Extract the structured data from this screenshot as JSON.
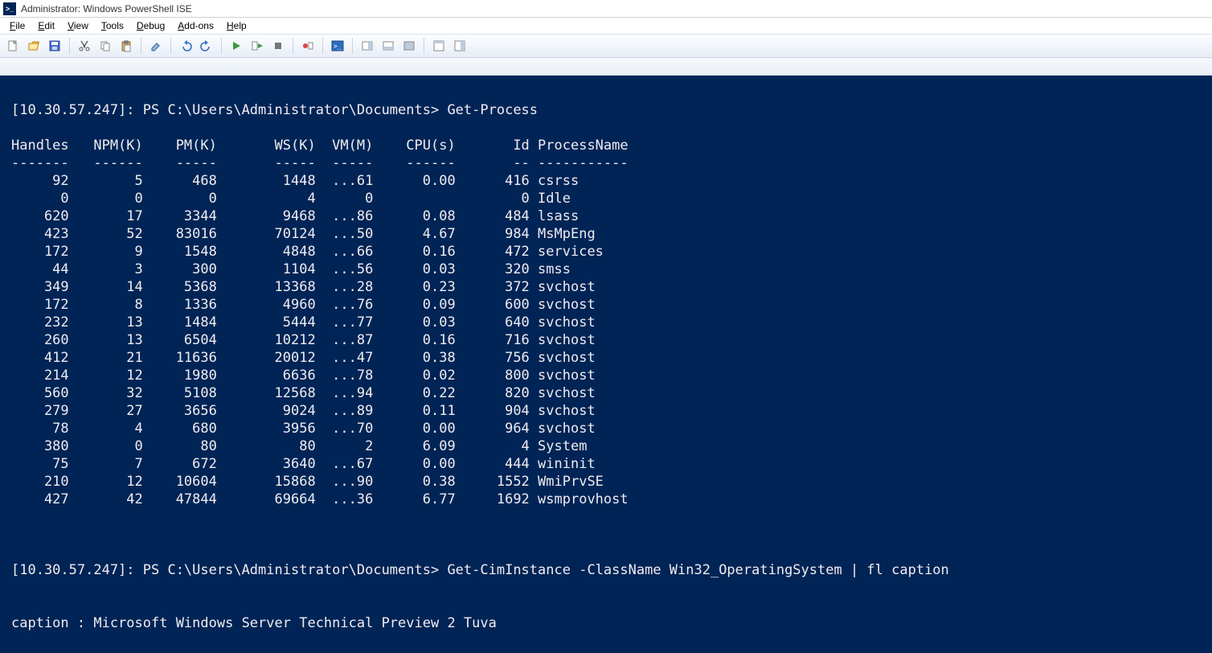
{
  "window": {
    "title": "Administrator: Windows PowerShell ISE"
  },
  "menu": {
    "file": {
      "label": "File",
      "ul": "F"
    },
    "edit": {
      "label": "Edit",
      "ul": "E"
    },
    "view": {
      "label": "View",
      "ul": "V"
    },
    "tools": {
      "label": "Tools",
      "ul": "T"
    },
    "debug": {
      "label": "Debug",
      "ul": "D"
    },
    "addons": {
      "label": "Add-ons",
      "ul": "A"
    },
    "help": {
      "label": "Help",
      "ul": "H"
    }
  },
  "toolbar_icons": [
    "new-icon",
    "open-icon",
    "save-icon",
    "sep",
    "cut-icon",
    "copy-icon",
    "paste-icon",
    "sep",
    "clear-icon",
    "sep",
    "undo-icon",
    "redo-icon",
    "sep",
    "run-icon",
    "run-selection-icon",
    "stop-icon",
    "sep",
    "breakpoint-icon",
    "sep",
    "powershell-icon",
    "sep",
    "layout-right-icon",
    "layout-bottom-icon",
    "layout-full-icon",
    "sep",
    "show-script-icon",
    "show-command-icon"
  ],
  "console": {
    "prompt1": "[10.30.57.247]: PS C:\\Users\\Administrator\\Documents> ",
    "cmd1": "Get-Process",
    "columns": [
      "Handles",
      "NPM(K)",
      "PM(K)",
      "WS(K)",
      "VM(M)",
      "CPU(s)",
      "Id",
      "ProcessName"
    ],
    "rows": [
      {
        "Handles": "92",
        "NPM": "5",
        "PM": "468",
        "WS": "1448",
        "VM": "...61",
        "CPU": "0.00",
        "Id": "416",
        "Name": "csrss"
      },
      {
        "Handles": "0",
        "NPM": "0",
        "PM": "0",
        "WS": "4",
        "VM": "0",
        "CPU": "",
        "Id": "0",
        "Name": "Idle"
      },
      {
        "Handles": "620",
        "NPM": "17",
        "PM": "3344",
        "WS": "9468",
        "VM": "...86",
        "CPU": "0.08",
        "Id": "484",
        "Name": "lsass"
      },
      {
        "Handles": "423",
        "NPM": "52",
        "PM": "83016",
        "WS": "70124",
        "VM": "...50",
        "CPU": "4.67",
        "Id": "984",
        "Name": "MsMpEng"
      },
      {
        "Handles": "172",
        "NPM": "9",
        "PM": "1548",
        "WS": "4848",
        "VM": "...66",
        "CPU": "0.16",
        "Id": "472",
        "Name": "services"
      },
      {
        "Handles": "44",
        "NPM": "3",
        "PM": "300",
        "WS": "1104",
        "VM": "...56",
        "CPU": "0.03",
        "Id": "320",
        "Name": "smss"
      },
      {
        "Handles": "349",
        "NPM": "14",
        "PM": "5368",
        "WS": "13368",
        "VM": "...28",
        "CPU": "0.23",
        "Id": "372",
        "Name": "svchost"
      },
      {
        "Handles": "172",
        "NPM": "8",
        "PM": "1336",
        "WS": "4960",
        "VM": "...76",
        "CPU": "0.09",
        "Id": "600",
        "Name": "svchost"
      },
      {
        "Handles": "232",
        "NPM": "13",
        "PM": "1484",
        "WS": "5444",
        "VM": "...77",
        "CPU": "0.03",
        "Id": "640",
        "Name": "svchost"
      },
      {
        "Handles": "260",
        "NPM": "13",
        "PM": "6504",
        "WS": "10212",
        "VM": "...87",
        "CPU": "0.16",
        "Id": "716",
        "Name": "svchost"
      },
      {
        "Handles": "412",
        "NPM": "21",
        "PM": "11636",
        "WS": "20012",
        "VM": "...47",
        "CPU": "0.38",
        "Id": "756",
        "Name": "svchost"
      },
      {
        "Handles": "214",
        "NPM": "12",
        "PM": "1980",
        "WS": "6636",
        "VM": "...78",
        "CPU": "0.02",
        "Id": "800",
        "Name": "svchost"
      },
      {
        "Handles": "560",
        "NPM": "32",
        "PM": "5108",
        "WS": "12568",
        "VM": "...94",
        "CPU": "0.22",
        "Id": "820",
        "Name": "svchost"
      },
      {
        "Handles": "279",
        "NPM": "27",
        "PM": "3656",
        "WS": "9024",
        "VM": "...89",
        "CPU": "0.11",
        "Id": "904",
        "Name": "svchost"
      },
      {
        "Handles": "78",
        "NPM": "4",
        "PM": "680",
        "WS": "3956",
        "VM": "...70",
        "CPU": "0.00",
        "Id": "964",
        "Name": "svchost"
      },
      {
        "Handles": "380",
        "NPM": "0",
        "PM": "80",
        "WS": "80",
        "VM": "2",
        "CPU": "6.09",
        "Id": "4",
        "Name": "System"
      },
      {
        "Handles": "75",
        "NPM": "7",
        "PM": "672",
        "WS": "3640",
        "VM": "...67",
        "CPU": "0.00",
        "Id": "444",
        "Name": "wininit"
      },
      {
        "Handles": "210",
        "NPM": "12",
        "PM": "10604",
        "WS": "15868",
        "VM": "...90",
        "CPU": "0.38",
        "Id": "1552",
        "Name": "WmiPrvSE"
      },
      {
        "Handles": "427",
        "NPM": "42",
        "PM": "47844",
        "WS": "69664",
        "VM": "...36",
        "CPU": "6.77",
        "Id": "1692",
        "Name": "wsmprovhost"
      }
    ],
    "prompt2": "[10.30.57.247]: PS C:\\Users\\Administrator\\Documents> ",
    "cmd2": "Get-CimInstance -ClassName Win32_OperatingSystem | fl caption",
    "result2_label": "caption : ",
    "result2_value": "Microsoft Windows Server Technical Preview 2 Tuva"
  }
}
